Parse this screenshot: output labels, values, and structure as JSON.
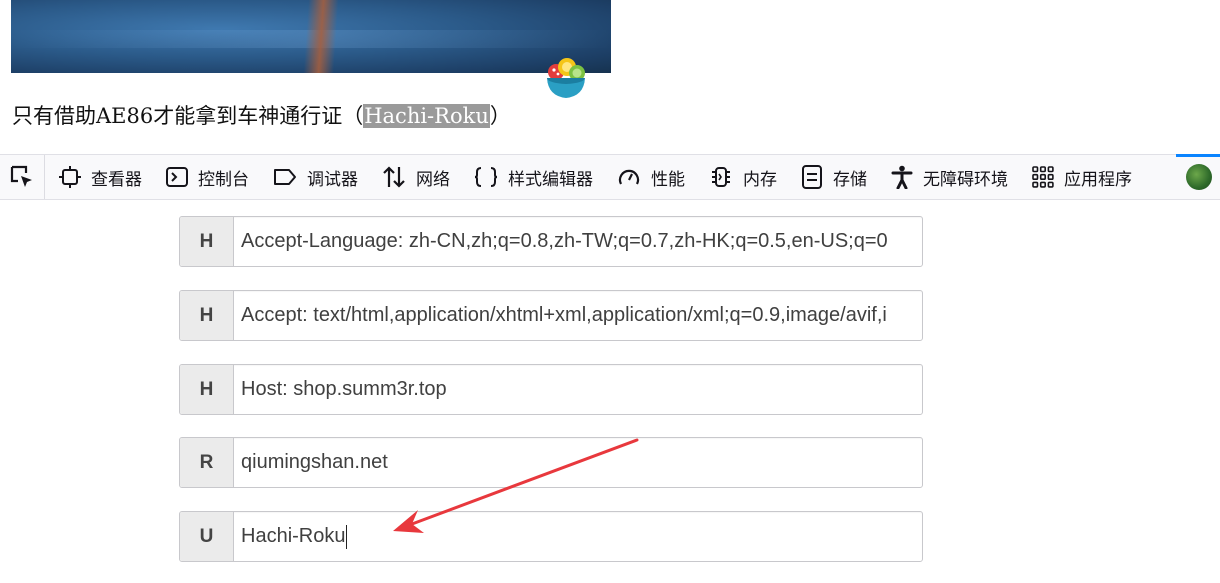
{
  "page": {
    "caption_prefix": "只有借助AE86才能拿到车神通行证（",
    "caption_highlight": "Hachi-Roku",
    "caption_suffix": "）"
  },
  "toolbar": {
    "tools": [
      {
        "label": "查看器",
        "icon": "inspector-icon"
      },
      {
        "label": "控制台",
        "icon": "console-icon"
      },
      {
        "label": "调试器",
        "icon": "debugger-icon"
      },
      {
        "label": "网络",
        "icon": "network-icon"
      },
      {
        "label": "样式编辑器",
        "icon": "style-editor-icon"
      },
      {
        "label": "性能",
        "icon": "performance-icon"
      },
      {
        "label": "内存",
        "icon": "memory-icon"
      },
      {
        "label": "存储",
        "icon": "storage-icon"
      },
      {
        "label": "无障碍环境",
        "icon": "accessibility-icon"
      },
      {
        "label": "应用程序",
        "icon": "application-icon"
      }
    ],
    "active_color": "#0a84ff"
  },
  "rows": [
    {
      "tag": "H",
      "value": "Accept-Language: zh-CN,zh;q=0.8,zh-TW;q=0.7,zh-HK;q=0.5,en-US;q=0"
    },
    {
      "tag": "H",
      "value": "Accept: text/html,application/xhtml+xml,application/xml;q=0.9,image/avif,i"
    },
    {
      "tag": "H",
      "value": "Host: shop.summ3r.top"
    },
    {
      "tag": "R",
      "value": "qiumingshan.net"
    },
    {
      "tag": "U",
      "value": "Hachi-Roku"
    }
  ],
  "annotation": {
    "arrow_color": "#e8383d"
  }
}
